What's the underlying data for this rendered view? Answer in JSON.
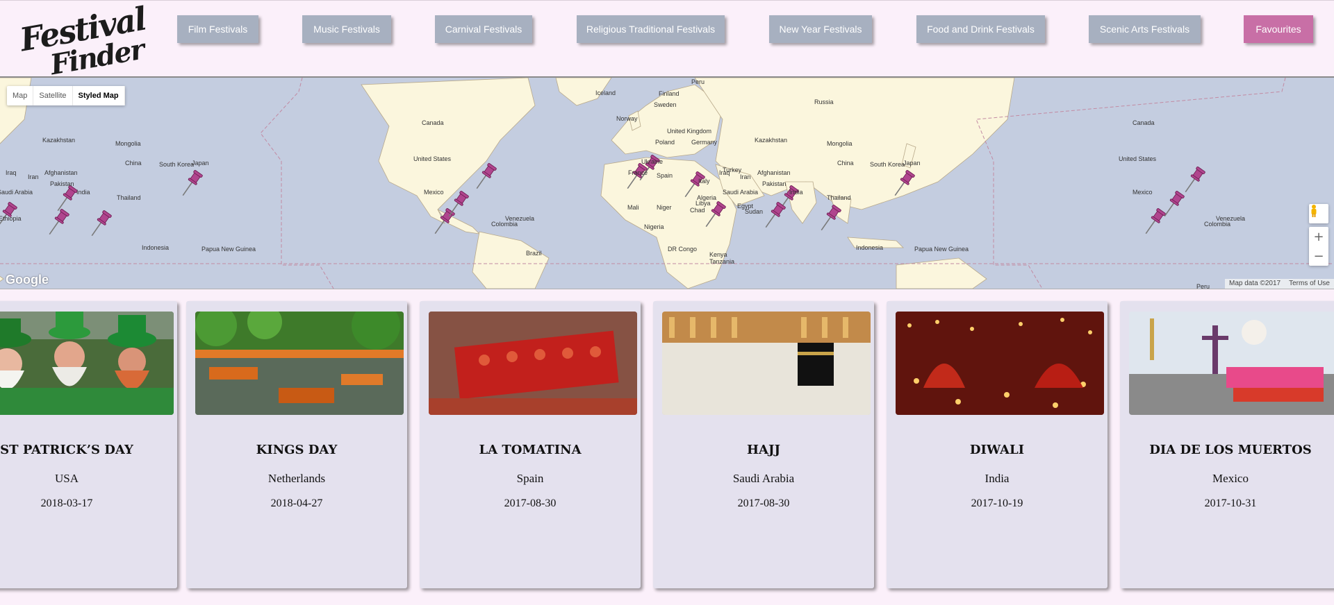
{
  "app": {
    "logo_line1": "Festival",
    "logo_line2": "Finder"
  },
  "nav": {
    "items": [
      {
        "label": "Film Festivals"
      },
      {
        "label": "Music Festivals"
      },
      {
        "label": "Carnival Festivals"
      },
      {
        "label": "Religious Traditional Festivals"
      },
      {
        "label": "New Year Festivals"
      },
      {
        "label": "Food and Drink Festivals"
      },
      {
        "label": "Scenic Arts Festivals"
      },
      {
        "label": "Favourites"
      }
    ]
  },
  "colors": {
    "nav_button": "#a7b0c0",
    "favourites_button": "#c86fa6",
    "page_bg": "#fbf0fa",
    "card_bg": "#e4e1ee",
    "land": "#fbf6dd",
    "water": "#c4cde0",
    "pin": "#b0458e"
  },
  "map": {
    "type_buttons": [
      "Map",
      "Satellite",
      "Styled Map"
    ],
    "active_type": "Styled Map",
    "zoom_in": "+",
    "zoom_out": "−",
    "attribution": "Map data ©2017",
    "terms": "Terms of Use",
    "brand": "Google",
    "labels": [
      "Russia",
      "Kazakhstan",
      "Mongolia",
      "China",
      "South Korea",
      "Japan",
      "Iraq",
      "Iran",
      "Afghanistan",
      "Pakistan",
      "Saudi Arabia",
      "India",
      "Thailand",
      "Ethiopia",
      "Indonesia",
      "Papua New Guinea",
      "Iceland",
      "Canada",
      "United States",
      "Mexico",
      "Venezuela",
      "Colombia",
      "Brazil",
      "Peru",
      "Finland",
      "Sweden",
      "Norway",
      "United Kingdom",
      "Poland",
      "Germany",
      "Ukraine",
      "France",
      "Spain",
      "Italy",
      "Turkey",
      "Algeria",
      "Libya",
      "Egypt",
      "Mali",
      "Niger",
      "Chad",
      "Sudan",
      "Nigeria",
      "DR Congo",
      "Kenya",
      "Tanzania",
      "Russia",
      "Kazakhstan",
      "Mongolia",
      "Afghanistan",
      "Iraq",
      "Iran",
      "Pakistan",
      "Saudi Arabia",
      "China",
      "South Korea",
      "Japan",
      "India",
      "Thailand",
      "Indonesia",
      "Papua New Guinea",
      "Canada",
      "United States",
      "Mexico",
      "Venezuela",
      "Colombia",
      "Peru"
    ],
    "pin_count": 19
  },
  "festivals": [
    {
      "name": "ST PATRICK’S DAY",
      "country": "USA",
      "date": "2018-03-17",
      "photo": "green-costumes"
    },
    {
      "name": "KINGS DAY",
      "country": "Netherlands",
      "date": "2018-04-27",
      "photo": "canal-boats"
    },
    {
      "name": "LA TOMATINA",
      "country": "Spain",
      "date": "2017-08-30",
      "photo": "tomato-crowd"
    },
    {
      "name": "HAJJ",
      "country": "Saudi Arabia",
      "date": "2017-08-30",
      "photo": "kaaba-pilgrims"
    },
    {
      "name": "DIWALI",
      "country": "India",
      "date": "2017-10-19",
      "photo": "oil-lamps"
    },
    {
      "name": "DIA DE LOS MUERTOS",
      "country": "Mexico",
      "date": "2017-10-31",
      "photo": "skeleton-parade"
    }
  ]
}
